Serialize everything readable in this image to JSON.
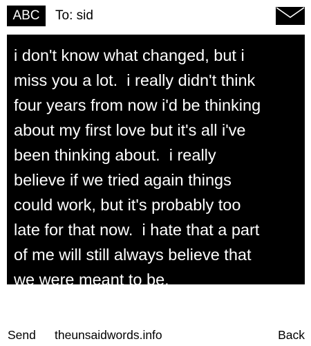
{
  "header": {
    "mode_badge": "ABC",
    "recipient_prefix": "To:",
    "recipient_name": "sid",
    "icon": "envelope-icon"
  },
  "message": {
    "lines": [
      "i don't know what changed, but i",
      "miss you a lot.  i really didn't think",
      "four years from now i'd be thinking",
      "about my first love but it's all i've",
      "been thinking about.  i really",
      "believe if we tried again things",
      "could work, but it's probably too",
      "late for that now.  i hate that a part",
      "of me will still always believe that",
      "we were meant to be."
    ]
  },
  "footer": {
    "send_label": "Send",
    "site_label": "theunsaidwords.info",
    "back_label": "Back"
  },
  "colors": {
    "background": "#ffffff",
    "message_background": "#000000",
    "message_text": "#ffffff",
    "text": "#000000"
  }
}
